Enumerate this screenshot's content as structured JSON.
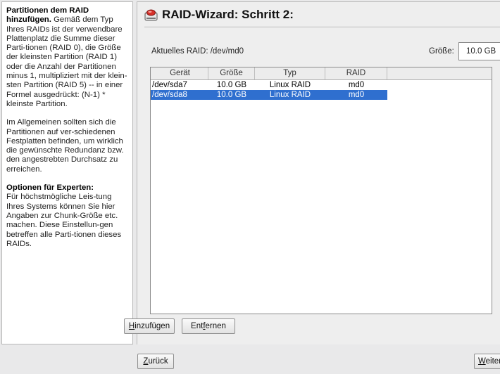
{
  "help": {
    "p1_head": "Partitionen dem RAID hinzufügen.",
    "p1_body": " Gemäß dem Typ Ihres RAIDs ist der verwendbare Plattenplatz die Summe dieser Parti-tionen (RAID 0), die Größe der kleinsten Partition (RAID 1) oder die Anzahl der Partitionen minus 1, multipliziert mit der klein-sten Partition (RAID 5) -- in einer Formel ausgedrückt: (N-1) * kleinste Partition.",
    "p2": "Im Allgemeinen sollten sich die Partitionen auf ver-schiedenen Festplatten befinden, um wirklich die gewünschte Redundanz bzw. den angestrebten Durchsatz zu erreichen.",
    "p3_head": "Optionen für Experten:",
    "p3_body": "Für höchstmögliche Leis-tung Ihres Systems können Sie hier Angaben zur Chunk-Größe etc. machen. Diese Einstellun-gen betreffen alle Parti-tionen dieses RAIDs."
  },
  "header": {
    "title": "RAID-Wizard: Schritt 2:",
    "icon": "raid-icon"
  },
  "raid_info": {
    "label": "Aktuelles RAID: /dev/md0",
    "size_label": "Größe:",
    "size_value": "10.0 GB"
  },
  "table": {
    "columns": [
      "Gerät",
      "Größe",
      "Typ",
      "RAID"
    ],
    "rows": [
      {
        "device": "/dev/sda7",
        "size": "10.0 GB",
        "type": "Linux RAID",
        "raid": "md0",
        "selected": false
      },
      {
        "device": "/dev/sda8",
        "size": "10.0 GB",
        "type": "Linux RAID",
        "raid": "md0",
        "selected": true
      }
    ]
  },
  "buttons": {
    "add_mnemonic": "H",
    "add_rest": "inzufügen",
    "remove_pre": "Ent",
    "remove_mnemonic": "f",
    "remove_rest": "ernen",
    "back_mnemonic": "Z",
    "back_rest": "urück",
    "next_mnemonic": "W",
    "next_rest": "eiter"
  },
  "colors": {
    "selection": "#2f6fcf",
    "icon_red": "#d8312a"
  }
}
